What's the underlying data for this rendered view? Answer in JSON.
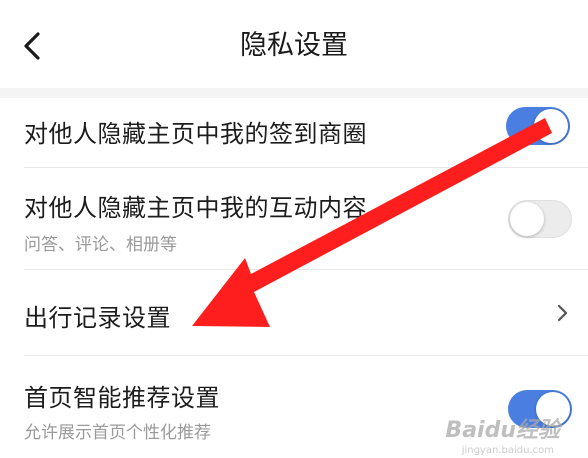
{
  "header": {
    "title": "隐私设置",
    "back_icon": "chevron-left-icon"
  },
  "settings": [
    {
      "title": "对他人隐藏主页中我的签到商圈",
      "subtitle": "",
      "control": "toggle",
      "enabled": true
    },
    {
      "title": "对他人隐藏主页中我的互动内容",
      "subtitle": "问答、评论、相册等",
      "control": "toggle",
      "enabled": false
    },
    {
      "title": "出行记录设置",
      "subtitle": "",
      "control": "chevron",
      "icon": "chevron-right-icon"
    },
    {
      "title": "首页智能推荐设置",
      "subtitle": "允许展示首页个性化推荐",
      "control": "toggle",
      "enabled": true
    }
  ],
  "annotation": {
    "type": "red-arrow",
    "color": "#ff1e1e",
    "from": "toggle of first setting",
    "to": "出行记录设置"
  },
  "watermark": {
    "text": "Baidu经验",
    "sub": "jingyan.baidu.com"
  },
  "colors": {
    "toggle_on": "#4a7ee0",
    "toggle_off": "#ececec",
    "arrow": "#ff1e1e"
  }
}
